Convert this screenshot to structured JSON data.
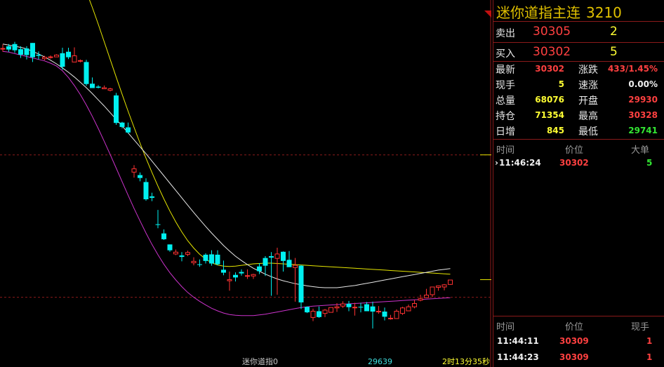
{
  "instrument": {
    "name": "迷你道指主连",
    "code": "3210"
  },
  "quote": {
    "sell": {
      "label": "卖出",
      "price": "30305",
      "volume": "2"
    },
    "buy": {
      "label": "买入",
      "price": "30302",
      "volume": "5"
    }
  },
  "stats": [
    {
      "label": "最新",
      "value": "30302",
      "color": "#ff4040"
    },
    {
      "label": "涨跌",
      "value": "433/1.45%",
      "color": "#ff4040"
    },
    {
      "label": "现手",
      "value": "5",
      "color": "#ffff33"
    },
    {
      "label": "速涨",
      "value": "0.00%",
      "color": "#f0f0f0"
    },
    {
      "label": "总量",
      "value": "68076",
      "color": "#ffff33"
    },
    {
      "label": "开盘",
      "value": "29930",
      "color": "#ff4040"
    },
    {
      "label": "持仓",
      "value": "71354",
      "color": "#ffff33"
    },
    {
      "label": "最高",
      "value": "30328",
      "color": "#ff4040"
    },
    {
      "label": "日增",
      "value": "845",
      "color": "#ffff33"
    },
    {
      "label": "最低",
      "value": "29741",
      "color": "#33e633"
    }
  ],
  "big_orders": {
    "headers": {
      "time": "时间",
      "price": "价位",
      "size": "大单"
    },
    "rows": [
      {
        "time": "11:46:24",
        "price": "30302",
        "size": "5"
      }
    ]
  },
  "ticks": {
    "headers": {
      "time": "时间",
      "price": "价位",
      "size": "现手"
    },
    "rows": [
      {
        "time": "11:44:11",
        "price": "30309",
        "size": "1"
      },
      {
        "time": "11:44:23",
        "price": "30309",
        "size": "1"
      }
    ]
  },
  "chart_footer": {
    "name": "迷你道指0",
    "low_marker": "29639",
    "countdown": "2时13分35秒"
  },
  "chart_data": {
    "type": "candlestick",
    "y_range": [
      29560,
      30560
    ],
    "reference_lines": [
      30138,
      29750
    ],
    "candles": [
      [
        30428,
        30439,
        30419,
        30428
      ],
      [
        30434,
        30440,
        30419,
        30425
      ],
      [
        30440,
        30446,
        30416,
        30423
      ],
      [
        30426,
        30434,
        30402,
        30411
      ],
      [
        30428,
        30434,
        30398,
        30410
      ],
      [
        30443,
        30443,
        30391,
        30404
      ],
      [
        30411,
        30420,
        30398,
        30408
      ],
      [
        30400,
        30408,
        30396,
        30404
      ],
      [
        30404,
        30409,
        30400,
        30405
      ],
      [
        30405,
        30412,
        30405,
        30410
      ],
      [
        30415,
        30430,
        30370,
        30378
      ],
      [
        30419,
        30430,
        30399,
        30404
      ],
      [
        30391,
        30431,
        30396,
        30408
      ],
      [
        30393,
        30398,
        30390,
        30395
      ],
      [
        30391,
        30397,
        30326,
        30331
      ],
      [
        30332,
        30349,
        30320,
        30320
      ],
      [
        30324,
        30328,
        30319,
        30321
      ],
      [
        30318,
        30327,
        30318,
        30321
      ],
      [
        30314,
        30321,
        30311,
        30318
      ],
      [
        30300,
        30307,
        30220,
        30225
      ],
      [
        30226,
        30228,
        30210,
        30214
      ],
      [
        30213,
        30226,
        30196,
        30199
      ],
      [
        30091,
        30110,
        30076,
        30100
      ],
      [
        30083,
        30090,
        30066,
        30075
      ],
      [
        30064,
        30074,
        30013,
        30017
      ],
      [
        30025,
        30035,
        30012,
        30021
      ],
      [
        29949,
        29988,
        29938,
        29947
      ],
      [
        29924,
        29935,
        29906,
        29908
      ],
      [
        29894,
        29894,
        29874,
        29878
      ],
      [
        29868,
        29880,
        29865,
        29873
      ],
      [
        29864,
        29873,
        29848,
        29860
      ],
      [
        29867,
        29877,
        29862,
        29872
      ],
      [
        29844,
        29859,
        29837,
        29848
      ],
      [
        29840,
        29853,
        29833,
        29839
      ],
      [
        29866,
        29870,
        29842,
        29849
      ],
      [
        29867,
        29878,
        29836,
        29842
      ],
      [
        29866,
        29878,
        29837,
        29840
      ],
      [
        29825,
        29850,
        29810,
        29817
      ],
      [
        29795,
        29820,
        29768,
        29798
      ],
      [
        29811,
        29818,
        29793,
        29804
      ],
      [
        29819,
        29826,
        29809,
        29815
      ],
      [
        29808,
        29826,
        29800,
        29809
      ],
      [
        29808,
        29814,
        29800,
        29812
      ],
      [
        29834,
        29843,
        29813,
        29821
      ],
      [
        29857,
        29862,
        29808,
        29836
      ],
      [
        29862,
        29873,
        29754,
        29858
      ],
      [
        29856,
        29885,
        29757,
        29868
      ],
      [
        29874,
        29875,
        29820,
        29849
      ],
      [
        29852,
        29876,
        29835,
        29832
      ],
      [
        29831,
        29857,
        29738,
        29837
      ],
      [
        29836,
        29838,
        29718,
        29736
      ],
      [
        29724,
        29725,
        29707,
        29709
      ],
      [
        29695,
        29719,
        29685,
        29712
      ],
      [
        29712,
        29725,
        29694,
        29696
      ],
      [
        29706,
        29718,
        29696,
        29715
      ],
      [
        29709,
        29720,
        29718,
        29722
      ],
      [
        29721,
        29734,
        29710,
        29724
      ],
      [
        29726,
        29739,
        29721,
        29732
      ],
      [
        29732,
        29740,
        29712,
        29723
      ],
      [
        29723,
        29735,
        29700,
        29723
      ],
      [
        29724,
        29735,
        29709,
        29722
      ],
      [
        29731,
        29737,
        29717,
        29712
      ],
      [
        29725,
        29738,
        29665,
        29711
      ],
      [
        29710,
        29726,
        29705,
        29712
      ],
      [
        29711,
        29722,
        29687,
        29697
      ],
      [
        29693,
        29702,
        29689,
        29693
      ],
      [
        29692,
        29717,
        29694,
        29712
      ],
      [
        29706,
        29724,
        29702,
        29721
      ],
      [
        29713,
        29730,
        29713,
        29724
      ],
      [
        29724,
        29743,
        29720,
        29733
      ],
      [
        29742,
        29757,
        29739,
        29746
      ],
      [
        29749,
        29773,
        29748,
        29756
      ],
      [
        29757,
        29777,
        29750,
        29778
      ],
      [
        29777,
        29782,
        29768,
        29781
      ],
      [
        29778,
        29786,
        29769,
        29784
      ],
      [
        29785,
        29797,
        29784,
        29797
      ]
    ],
    "ma_white": [
      30440,
      30437,
      30434,
      30431,
      30427,
      30420,
      30413,
      30405,
      30396,
      30386,
      30375,
      30363,
      30350,
      30336,
      30321,
      30305,
      30288,
      30271,
      30253,
      30235,
      30217,
      30198,
      30179,
      30160,
      30141,
      30121,
      30101,
      30081,
      30061,
      30041,
      30021,
      30001,
      29981,
      29962,
      29943,
      29925,
      29908,
      29891,
      29876,
      29862,
      29850,
      29839,
      29829,
      29821,
      29813,
      29806,
      29800,
      29795,
      29791,
      29787,
      29784,
      29781,
      29779,
      29777,
      29776,
      29776,
      29776,
      29778,
      29780,
      29782,
      29785,
      29788,
      29791,
      29794,
      29797,
      29800,
      29803,
      29806,
      29809,
      29812,
      29815,
      29818,
      29821,
      29824,
      29826,
      29828
    ],
    "band_upper": [
      30860,
      30856,
      30850,
      30843,
      30834,
      30822,
      30807,
      30790,
      30770,
      30748,
      30722,
      30693,
      30660,
      30623,
      30583,
      30540,
      30494,
      30446,
      30398,
      30350,
      30303,
      30257,
      30213,
      30170,
      30129,
      30090,
      30053,
      30018,
      29985,
      29955,
      29928,
      29904,
      29884,
      29867,
      29854,
      29844,
      29838,
      29835,
      29834,
      29835,
      29837,
      29839,
      29841,
      29842,
      29843,
      29843,
      29842,
      29841,
      29840,
      29839,
      29838,
      29837,
      29836,
      29835,
      29834,
      29833,
      29832,
      29831,
      29830,
      29829,
      29828,
      29827,
      29826,
      29825,
      29824,
      29823,
      29822,
      29821,
      29820,
      29819,
      29818,
      29817,
      29816,
      29815,
      29814,
      29813
    ],
    "band_lower": [
      30420,
      30418,
      30414,
      30410,
      30406,
      30402,
      30398,
      30394,
      30388,
      30380,
      30367,
      30349,
      30327,
      30302,
      30274,
      30243,
      30210,
      30175,
      30139,
      30102,
      30065,
      30028,
      29992,
      29958,
      29925,
      29894,
      29866,
      29840,
      29817,
      29797,
      29779,
      29763,
      29750,
      29739,
      29729,
      29720,
      29713,
      29707,
      29703,
      29701,
      29700,
      29700,
      29700,
      29702,
      29704,
      29707,
      29710,
      29713,
      29716,
      29719,
      29722,
      29724,
      29726,
      29727,
      29728,
      29729,
      29730,
      29731,
      29732,
      29733,
      29734,
      29735,
      29736,
      29737,
      29738,
      29739,
      29740,
      29741,
      29742,
      29743,
      29744,
      29745,
      29746,
      29747,
      29748,
      29749
    ]
  }
}
